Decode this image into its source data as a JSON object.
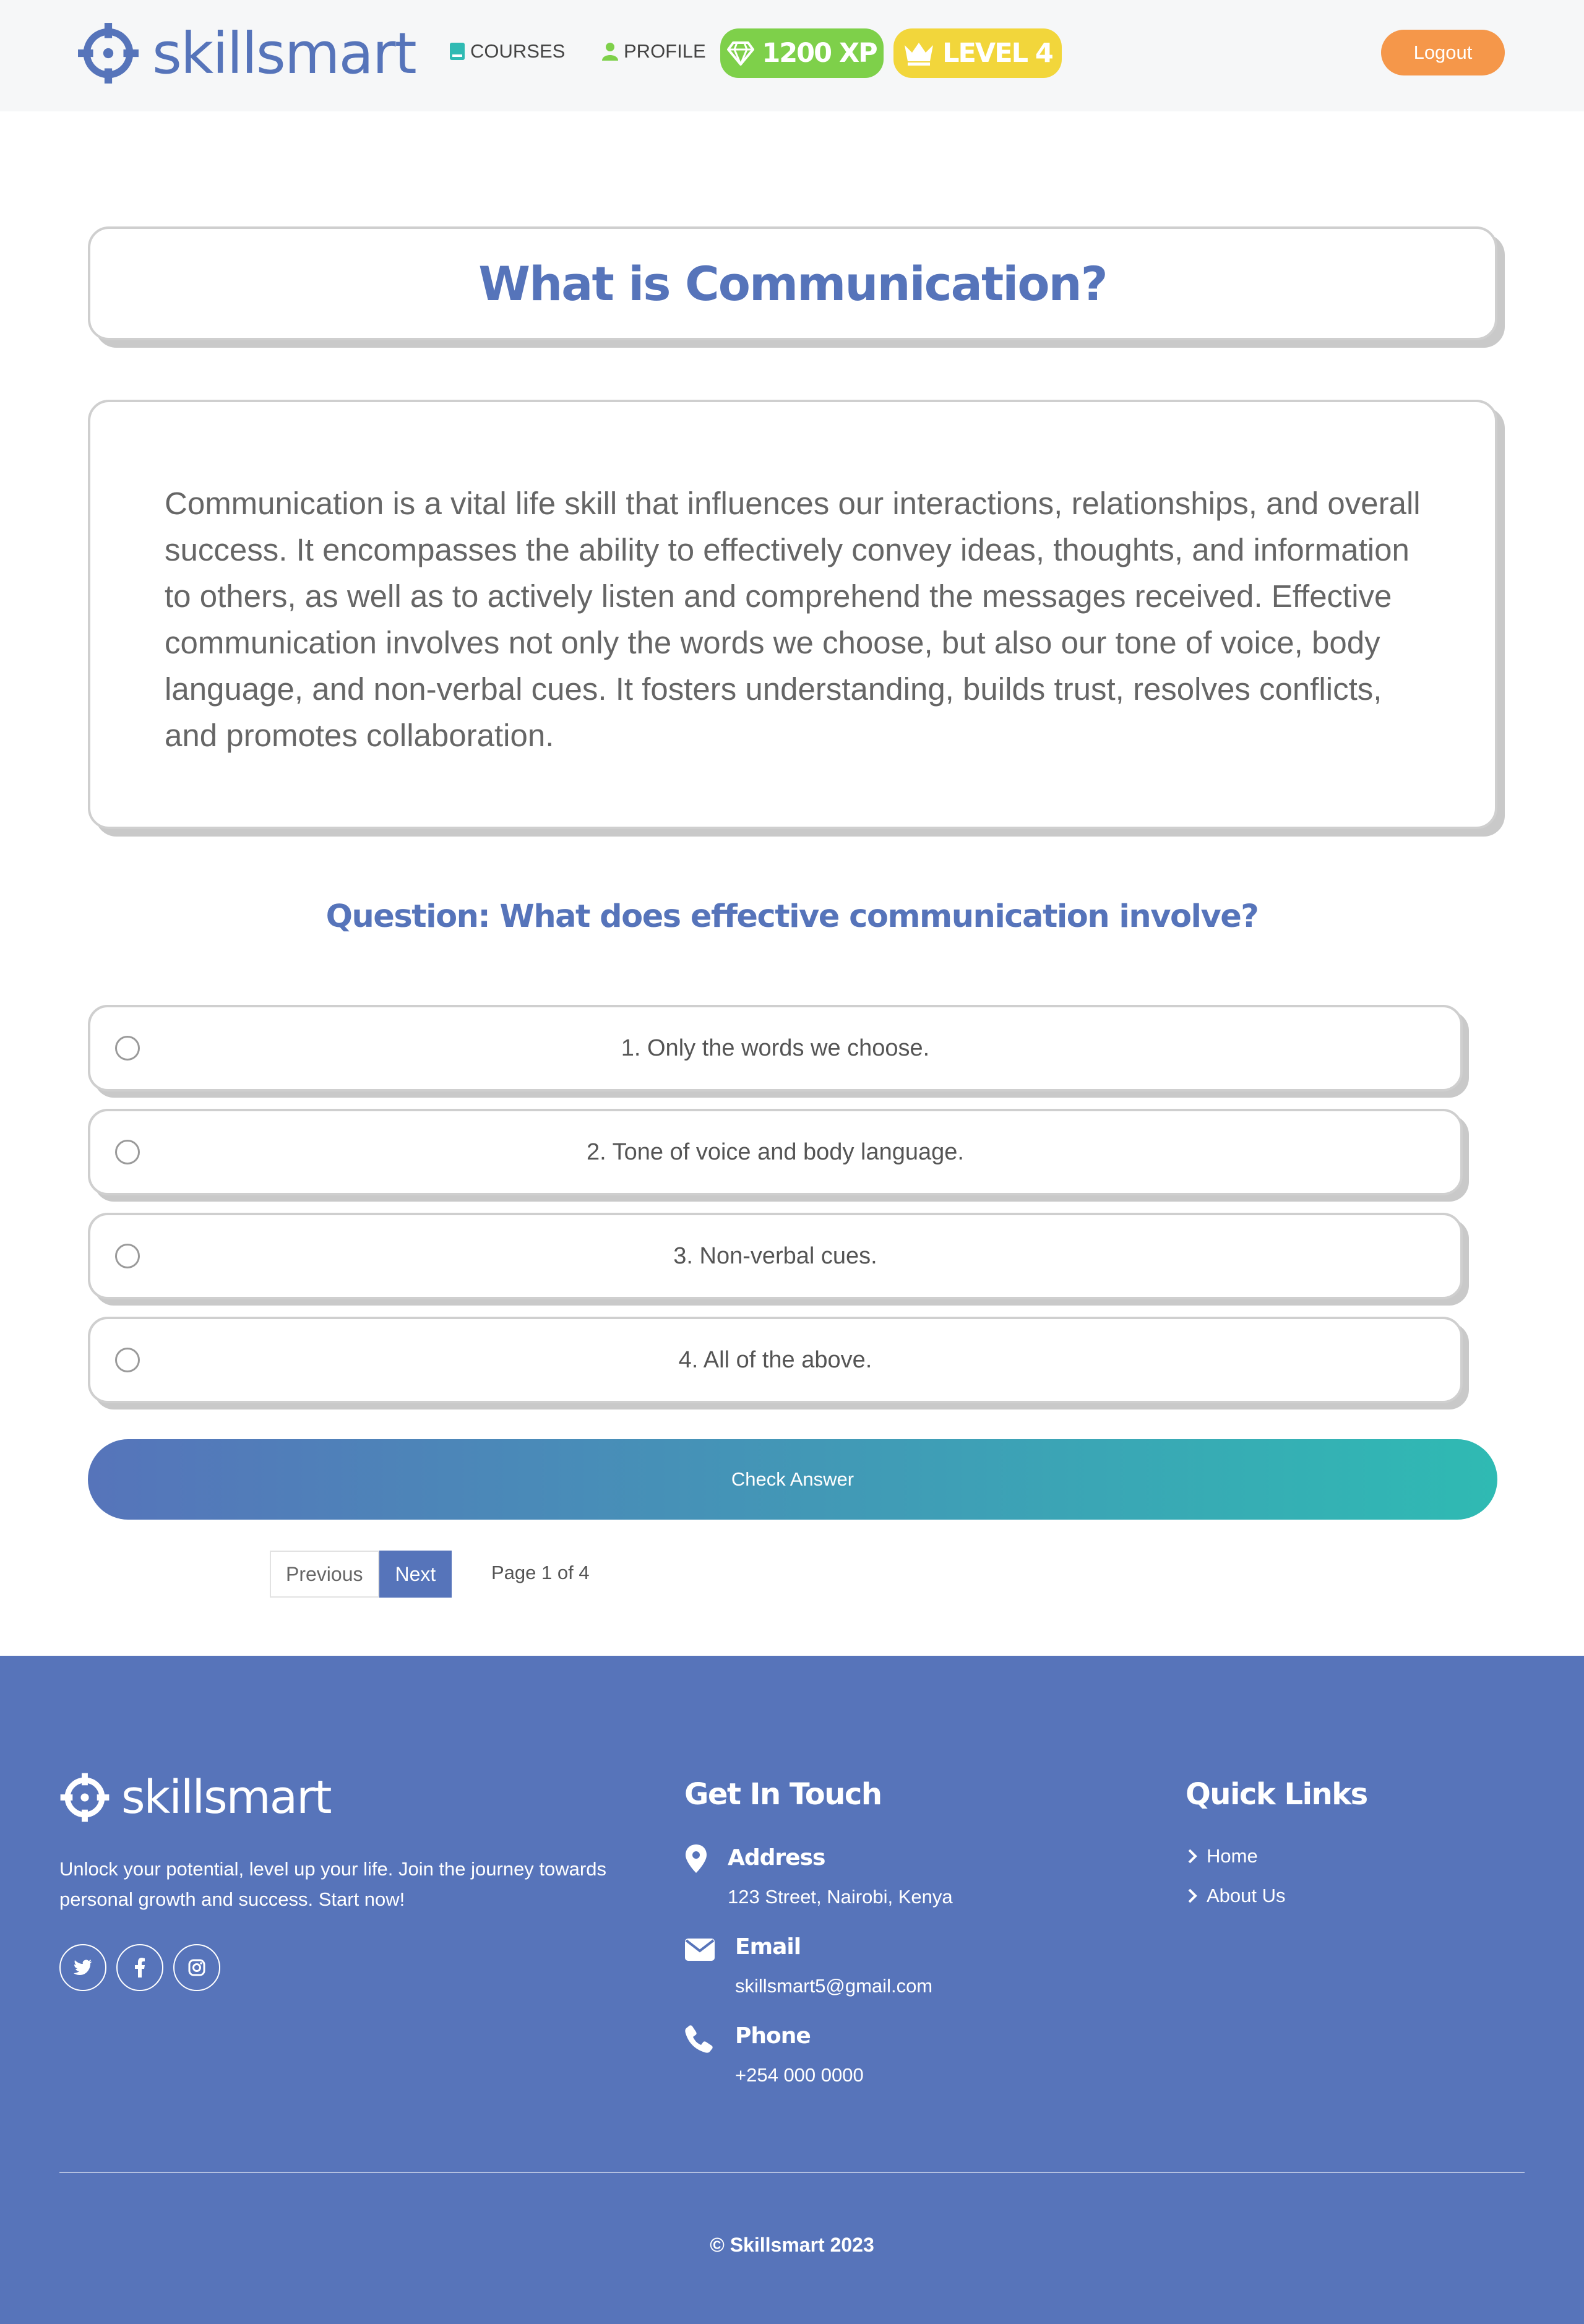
{
  "nav": {
    "brand": "skillsmart",
    "courses": "COURSES",
    "profile": "PROFILE",
    "xp": "1200 XP",
    "level": "LEVEL 4",
    "logout": "Logout"
  },
  "lesson": {
    "title": "What is Communication?",
    "body": "Communication is a vital life skill that influences our interactions, relationships, and overall success. It encompasses the ability to effectively convey ideas, thoughts, and information to others, as well as to actively listen and comprehend the messages received. Effective communication involves not only the words we choose, but also our tone of voice, body language, and non-verbal cues. It fosters understanding, builds trust, resolves conflicts, and promotes collaboration."
  },
  "quiz": {
    "question": "Question: What does effective communication involve?",
    "options": [
      "1. Only the words we choose.",
      "2. Tone of voice and body language.",
      "3. Non-verbal cues.",
      "4. All of the above."
    ],
    "check_label": "Check Answer"
  },
  "pagination": {
    "previous": "Previous",
    "next": "Next",
    "info": "Page 1 of 4"
  },
  "footer": {
    "brand": "skillsmart",
    "description": "Unlock your potential, level up your life. Join the journey towards personal growth and success. Start now!",
    "get_in_touch": "Get In Touch",
    "address_label": "Address",
    "address": "123 Street, Nairobi, Kenya",
    "email_label": "Email",
    "email": "skillsmart5@gmail.com",
    "phone_label": "Phone",
    "phone": "+254 000 0000",
    "quick_links": "Quick Links",
    "links": [
      "Home",
      "About Us"
    ],
    "copyright": "© Skillsmart 2023"
  },
  "icons": {
    "brand_logo": "crosshair-icon",
    "courses": "book-icon",
    "profile": "user-icon",
    "xp": "gem-icon",
    "level": "crown-icon",
    "socials": [
      "twitter-icon",
      "facebook-icon",
      "instagram-icon"
    ],
    "address": "map-pin-icon",
    "email": "envelope-icon",
    "phone": "phone-icon",
    "link_chevron": "chevron-right-icon"
  },
  "colors": {
    "brand_blue": "#5674ba",
    "teal": "#2fbab3",
    "xp_green": "#7ed04a",
    "level_yellow": "#f2d63b",
    "logout_orange": "#f5974a",
    "footer_bg": "#5774ba"
  }
}
